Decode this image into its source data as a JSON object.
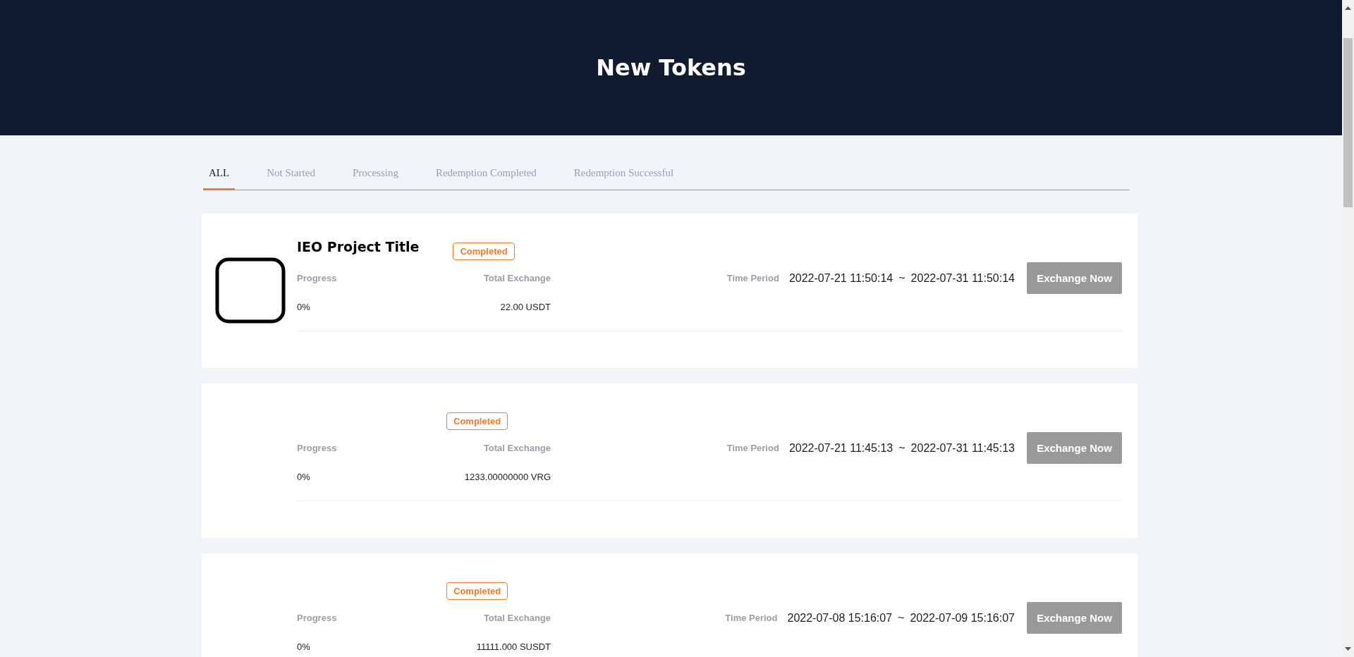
{
  "header": {
    "title": "New Tokens"
  },
  "tabs": [
    {
      "label": "ALL",
      "selected": true
    },
    {
      "label": "Not Started",
      "selected": false
    },
    {
      "label": "Processing",
      "selected": false
    },
    {
      "label": "Redemption Completed",
      "selected": false
    },
    {
      "label": "Redemption Successful",
      "selected": false
    }
  ],
  "projects": [
    {
      "logo": true,
      "title": "IEO Project Title",
      "status": "Completed",
      "progress_label": "Progress",
      "progress": "0%",
      "total_label": "Total Exchange",
      "total": "22.00 USDT",
      "period_label": "Time Period",
      "start": "2022-07-21 11:50:14",
      "separator": "~",
      "end": "2022-07-31 11:50:14",
      "button": "Exchange Now"
    },
    {
      "logo": false,
      "status": "Completed",
      "progress_label": "Progress",
      "progress": "0%",
      "total_label": "Total Exchange",
      "total": "1233.00000000 VRG",
      "period_label": "Time Period",
      "start": "2022-07-21 11:45:13",
      "separator": "~",
      "end": "2022-07-31 11:45:13",
      "button": "Exchange Now"
    },
    {
      "logo": false,
      "status": "Completed",
      "progress_label": "Progress",
      "progress": "0%",
      "total_label": "Total Exchange",
      "total": "11111.000 SUSDT",
      "period_label": "Time Period",
      "start": "2022-07-08 15:16:07",
      "separator": "~",
      "end": "2022-07-09 15:16:07",
      "button": "Exchange Now"
    }
  ]
}
